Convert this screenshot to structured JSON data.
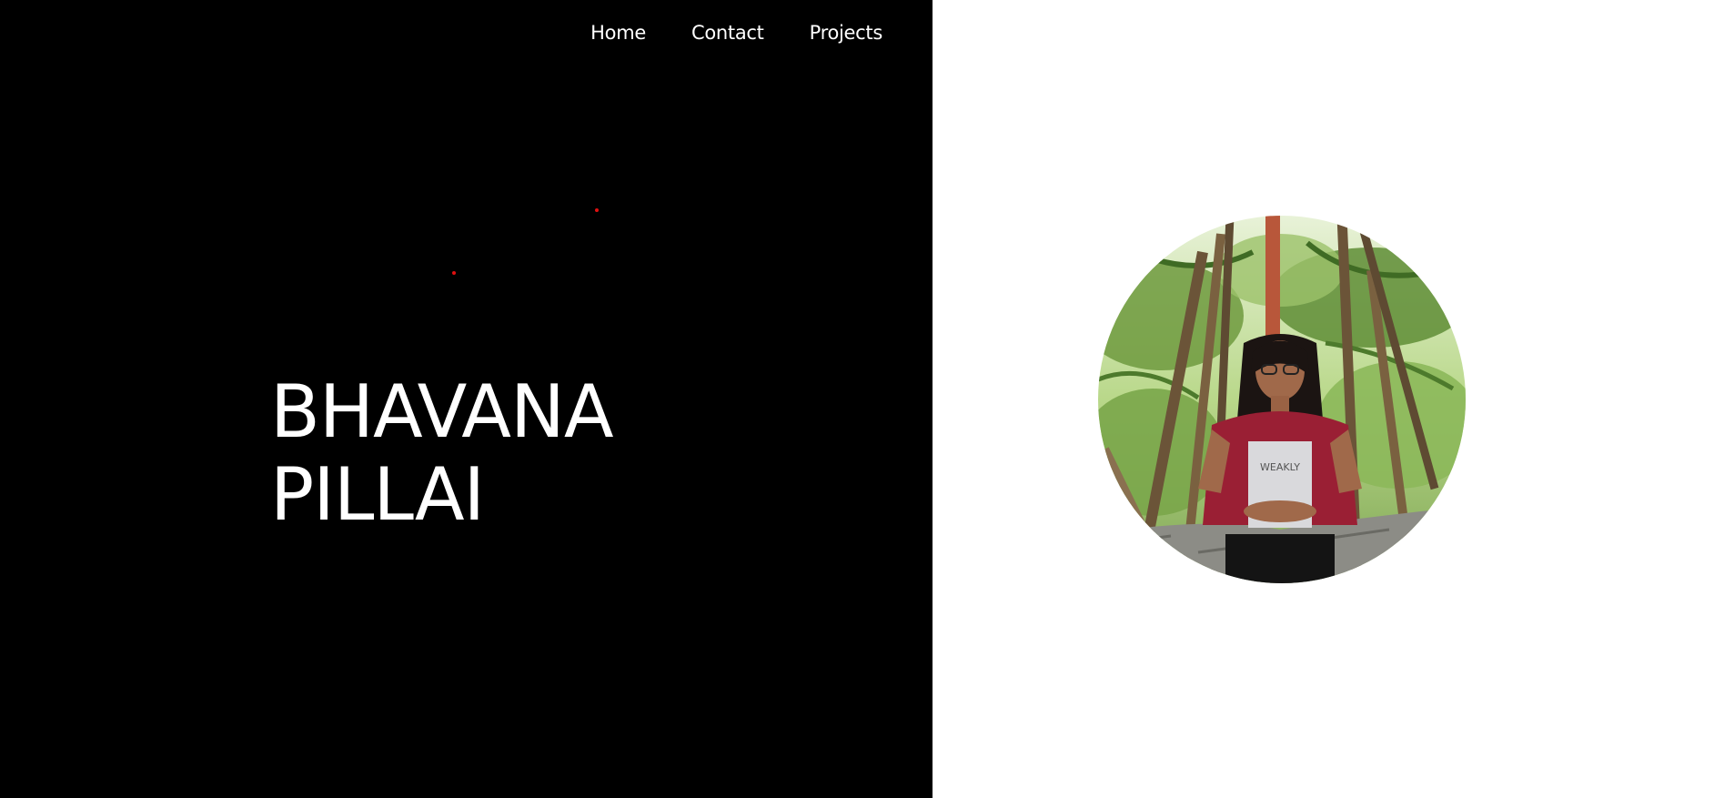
{
  "nav": {
    "home": "Home",
    "contact": "Contact",
    "projects": "Projects"
  },
  "hero": {
    "first_name": "BHAVANA",
    "last_name": "PILLAI"
  },
  "colors": {
    "left_background": "#000000",
    "right_background": "#ffffff",
    "text": "#ffffff",
    "particle": "#e01010"
  },
  "icons": {
    "particle": "red-dot",
    "profile": "profile-photo"
  }
}
